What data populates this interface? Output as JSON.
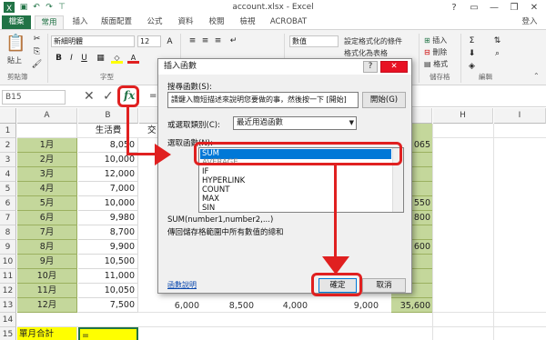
{
  "window": {
    "title": "account.xlsx - Excel",
    "user": "登入",
    "controls": [
      "?",
      "▭",
      "—",
      "❐",
      "✕"
    ]
  },
  "quick_access": [
    "save-icon",
    "undo-icon",
    "redo-icon",
    "customize-icon"
  ],
  "tabs": [
    "檔案",
    "常用",
    "插入",
    "版面配置",
    "公式",
    "資料",
    "校閱",
    "檢視",
    "ACROBAT"
  ],
  "ribbon": {
    "paste_label": "貼上",
    "font_name": "新細明體",
    "font_size": "12",
    "number_format": "數值",
    "cond_format": "設定格式化的條件",
    "format_table": "格式化為表格",
    "insert": "插入",
    "delete": "刪除",
    "format": "格式",
    "groups": {
      "clipboard": "剪貼簿",
      "font": "字型",
      "cells": "儲存格",
      "editing": "編輯"
    }
  },
  "formula_bar": {
    "name_box": "B15",
    "cancel": "✕",
    "enter": "✓",
    "fx": "fx",
    "content": "="
  },
  "sheet": {
    "columns": [
      "A",
      "B",
      "C",
      "D",
      "E",
      "F",
      "G",
      "H",
      "I"
    ],
    "rows": [
      "1",
      "2",
      "3",
      "4",
      "5",
      "6",
      "7",
      "8",
      "9",
      "10",
      "11",
      "12",
      "13",
      "14",
      "15"
    ],
    "b1": "生活費",
    "c1_partial": "交",
    "months": [
      "1月",
      "2月",
      "3月",
      "4月",
      "5月",
      "6月",
      "7月",
      "8月",
      "9月",
      "10月",
      "11月",
      "12月"
    ],
    "living": [
      "8,050",
      "10,000",
      "12,000",
      "7,000",
      "10,000",
      "9,980",
      "8,700",
      "9,900",
      "10,500",
      "11,000",
      "10,050",
      "7,500"
    ],
    "g_visible": [
      "065",
      "",
      "",
      "",
      "550",
      "800",
      "",
      "600",
      "",
      "",
      "",
      ""
    ],
    "row13_partial": [
      "6,000",
      "8,500",
      "4,000",
      "9,000",
      "35,600"
    ],
    "a15": "單月合計",
    "b15": "="
  },
  "dialog": {
    "title": "插入函數",
    "help": "?",
    "close": "✕",
    "search_label": "搜尋函數(S):",
    "search_placeholder": "請鍵入簡短描述來說明您要做的事，然後按一下 [開始]",
    "go_button": "開始(G)",
    "category_label": "或選取類別(C):",
    "category_value": "最近用過函數",
    "select_label": "選取函數(N):",
    "functions": [
      "SUM",
      "AVERAGE",
      "IF",
      "HYPERLINK",
      "COUNT",
      "MAX",
      "SIN"
    ],
    "syntax": "SUM(number1,number2,...)",
    "description": "傳回儲存格範圍中所有數值的總和",
    "help_link": "函數說明",
    "ok": "確定",
    "cancel": "取消"
  },
  "colors": {
    "excel_green": "#217346",
    "month_fill": "#c4d79b",
    "highlight_yellow": "#ffff00",
    "annotation_red": "#e02020",
    "selection_blue": "#0078d7"
  }
}
